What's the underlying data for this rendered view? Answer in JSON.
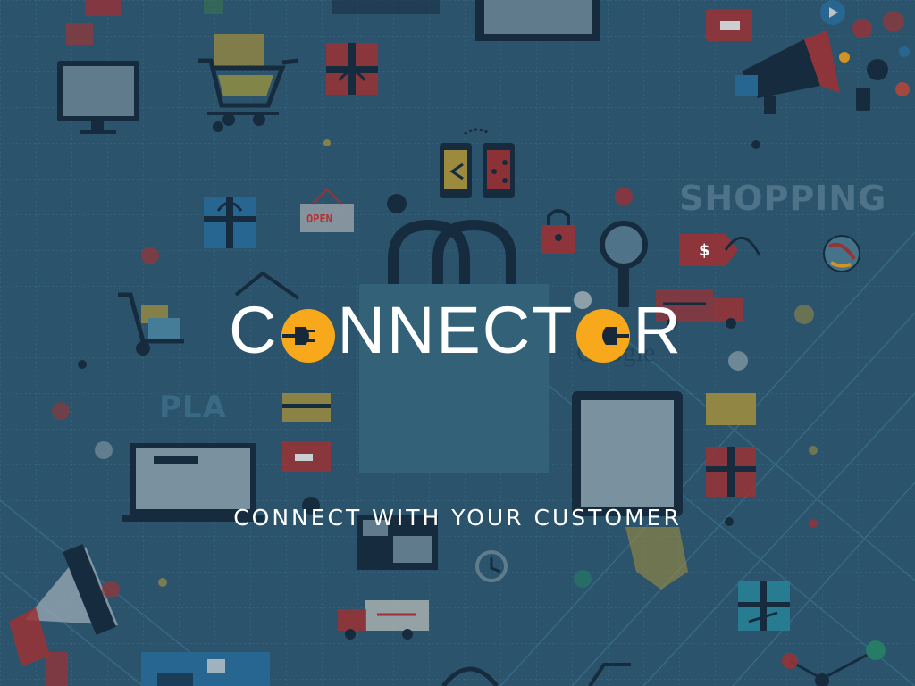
{
  "brand": {
    "pre": "C",
    "mid": "NNECT",
    "post": "R",
    "accent_color": "#f7a81b"
  },
  "tagline": "CONNECT WITH YOUR CUSTOMER",
  "decor": {
    "shopping": "SHOPPING",
    "google": "Google",
    "pla": "PLA",
    "open": "OPEN",
    "price": "$"
  },
  "colors": {
    "background": "#2f5a72",
    "grid": "#4a86a6",
    "icon_dark": "#17283a",
    "icon_red": "#b5302f",
    "accent": "#f7a81b"
  }
}
